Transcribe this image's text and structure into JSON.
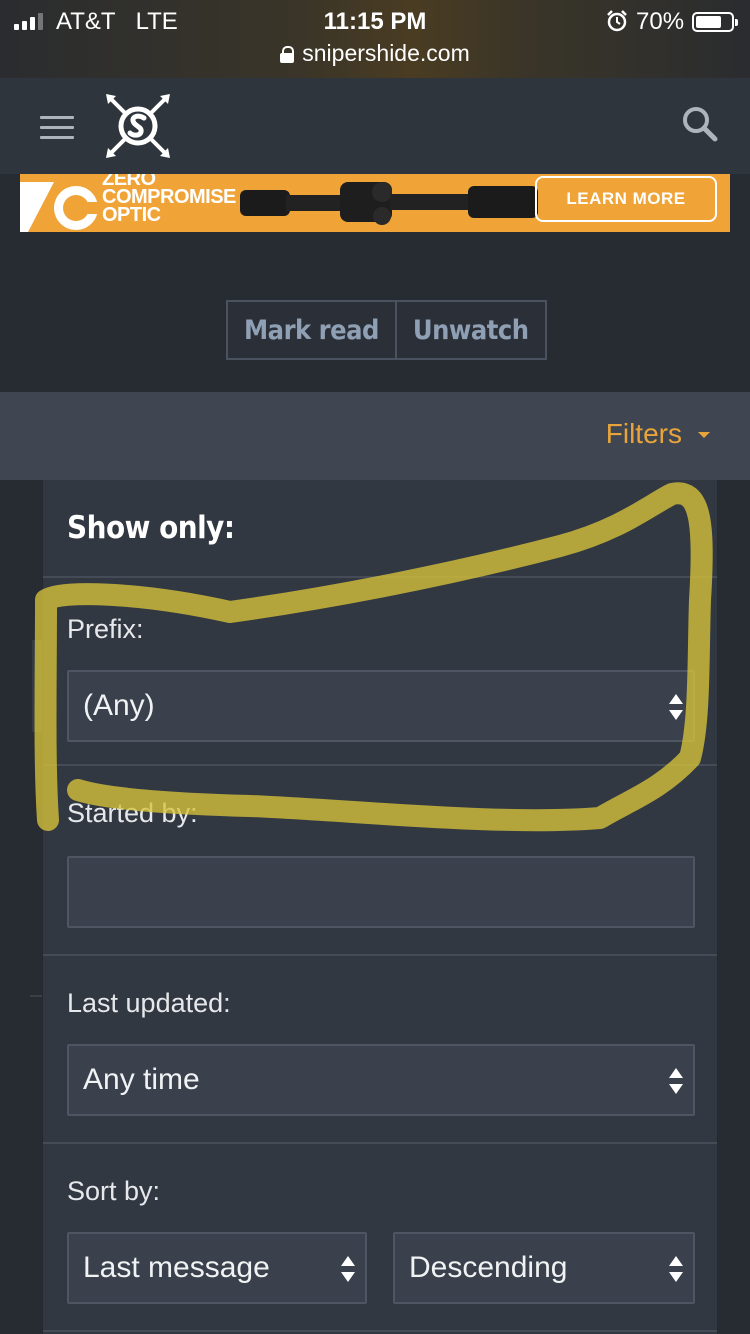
{
  "status": {
    "carrier": "AT&T",
    "network": "LTE",
    "time": "11:15 PM",
    "battery": "70%",
    "url": "snipershide.com"
  },
  "header": {
    "menu_icon": "hamburger-icon",
    "logo": "snipershide-logo",
    "search_icon": "search-icon"
  },
  "ad": {
    "brand_line1": "ZERO",
    "brand_line2": "COMPROMISE",
    "brand_line3": "OPTIC",
    "cta": "LEARN MORE",
    "accent": "#f0a438"
  },
  "actions": {
    "mark_read": "Mark read",
    "unwatch": "Unwatch"
  },
  "filters": {
    "toggle_label": "Filters",
    "accent": "#e8a43a",
    "title": "Show only:",
    "prefix_label": "Prefix:",
    "prefix_value": "(Any)",
    "started_by_label": "Started by:",
    "started_by_value": "",
    "last_updated_label": "Last updated:",
    "last_updated_value": "Any time",
    "sort_by_label": "Sort by:",
    "sort_field_value": "Last message",
    "sort_direction_value": "Descending"
  }
}
